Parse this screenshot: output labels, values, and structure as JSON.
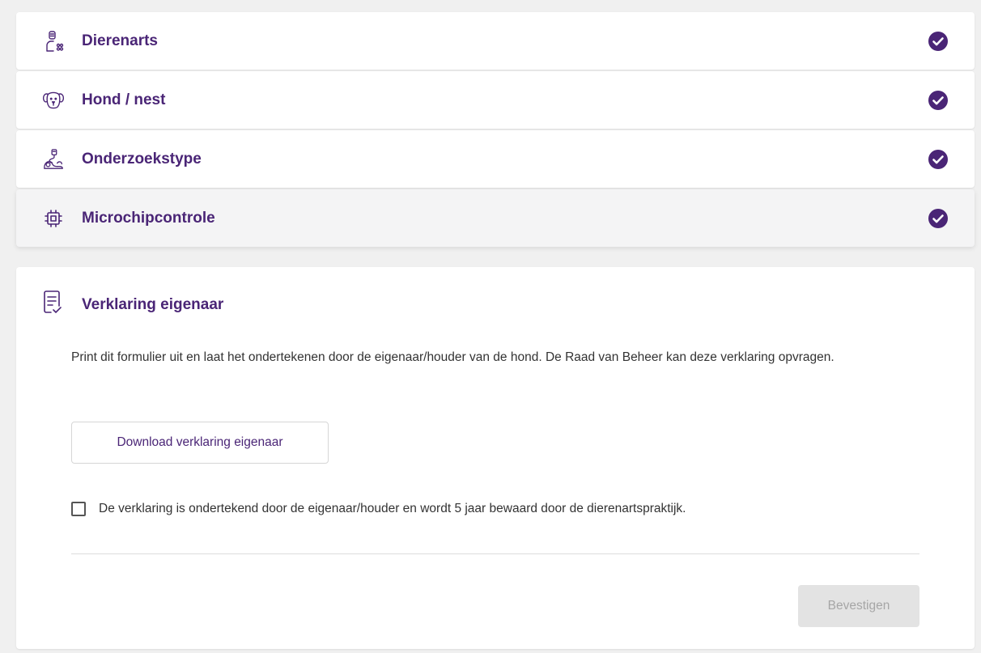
{
  "steps": [
    {
      "label": "Dierenarts",
      "icon": "veterinarian-icon",
      "completed": true
    },
    {
      "label": "Hond / nest",
      "icon": "dog-icon",
      "completed": true
    },
    {
      "label": "Onderzoekstype",
      "icon": "examination-icon",
      "completed": true
    },
    {
      "label": "Microchipcontrole",
      "icon": "microchip-icon",
      "completed": true
    }
  ],
  "panel": {
    "title": "Verklaring eigenaar",
    "icon": "document-check-icon",
    "description": "Print dit formulier uit en laat het ondertekenen door de eigenaar/houder van de hond. De Raad van Beheer kan deze verklaring opvragen.",
    "download_label": "Download verklaring eigenaar",
    "checkbox_label": "De verklaring is ondertekend door de eigenaar/houder en wordt 5 jaar bewaard door de dierenartspraktijk.",
    "checkbox_checked": false,
    "confirm_label": "Bevestigen",
    "confirm_disabled": true
  },
  "colors": {
    "accent": "#4a2576",
    "check": "#4a2576",
    "background": "#f0f0f0",
    "disabled_button_bg": "#e3e3e3",
    "disabled_button_text": "#a6a6a6"
  }
}
